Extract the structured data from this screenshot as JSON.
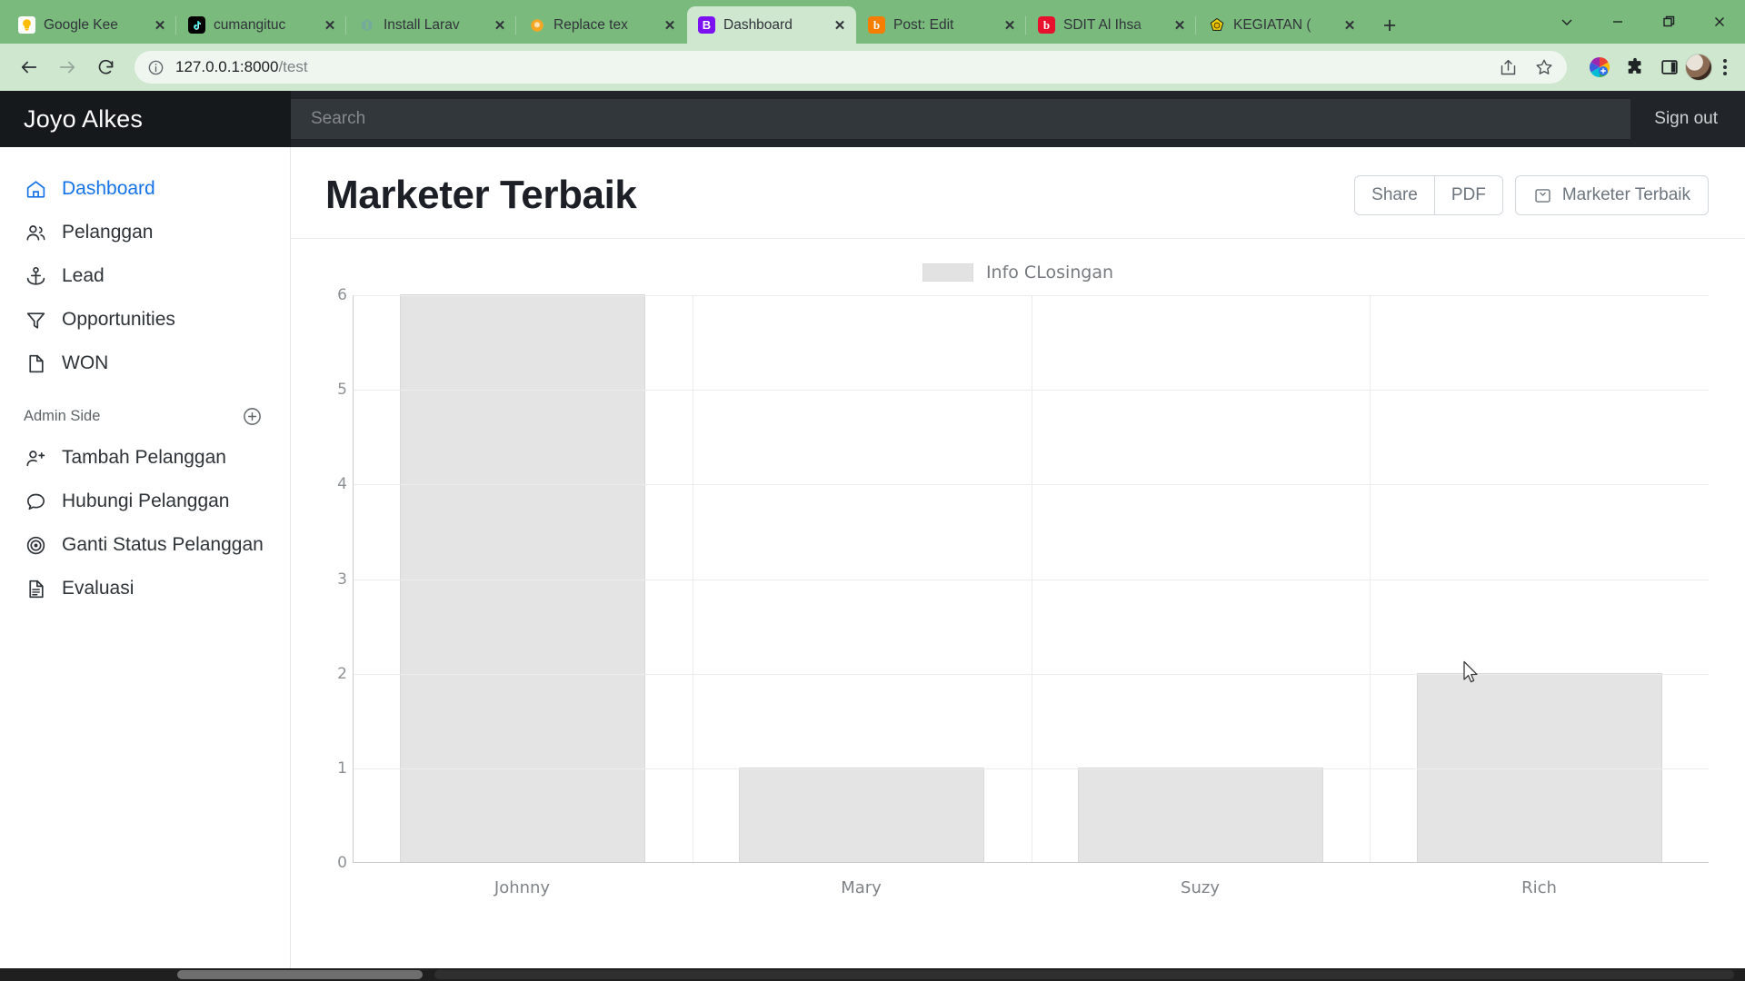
{
  "browser": {
    "tabs": [
      {
        "title": "Google Kee",
        "favicon": "keep-icon",
        "color": "#fbbc04",
        "active": false
      },
      {
        "title": "cumangituc",
        "favicon": "tiktok-icon",
        "color": "#000000",
        "active": false
      },
      {
        "title": "Install Larav",
        "favicon": "openai-icon",
        "color": "#74aa9c",
        "active": false
      },
      {
        "title": "Replace tex",
        "favicon": "orange-circle-icon",
        "color": "#f5a623",
        "active": false
      },
      {
        "title": "Dashboard",
        "favicon": "bootstrap-icon",
        "color": "#7b10f0",
        "active": true
      },
      {
        "title": "Post: Edit",
        "favicon": "blogger-icon",
        "color": "#f57d00",
        "active": false
      },
      {
        "title": "SDIT Al Ihsa",
        "favicon": "blogger-b-icon",
        "color": "#e8112d",
        "active": false
      },
      {
        "title": "KEGIATAN (",
        "favicon": "logo-icon",
        "color": "#f2d20a",
        "active": false
      }
    ],
    "new_tab_label": "+",
    "window_controls": [
      "chevron-down-icon",
      "minimize-icon",
      "maximize-icon",
      "close-icon"
    ],
    "nav": {
      "back": "back-arrow-icon",
      "forward": "forward-arrow-icon",
      "reload": "reload-icon"
    },
    "omnibox": {
      "site_info_icon": "info-circle-icon",
      "url_host": "127.0.0.1:8000",
      "url_path": "/test",
      "share_icon": "share-icon",
      "bookmark_icon": "star-icon"
    },
    "extensions": [
      "color-wheel-icon",
      "puzzle-extension-icon",
      "sidepanel-icon"
    ],
    "profile": "avatar",
    "menu": "kebab-menu-icon"
  },
  "app": {
    "brand": "Joyo Alkes",
    "search_placeholder": "Search",
    "search_value": "",
    "signout_label": "Sign out"
  },
  "sidebar": {
    "items": [
      {
        "label": "Dashboard",
        "icon": "home-icon",
        "active": true
      },
      {
        "label": "Pelanggan",
        "icon": "users-icon",
        "active": false
      },
      {
        "label": "Lead",
        "icon": "anchor-icon",
        "active": false
      },
      {
        "label": "Opportunities",
        "icon": "funnel-icon",
        "active": false
      },
      {
        "label": "WON",
        "icon": "file-icon",
        "active": false
      }
    ],
    "section": {
      "label": "Admin Side",
      "add_icon": "plus-circle-icon",
      "items": [
        {
          "label": "Tambah Pelanggan",
          "icon": "user-plus-icon"
        },
        {
          "label": "Hubungi Pelanggan",
          "icon": "chat-bubble-icon"
        },
        {
          "label": "Ganti Status Pelanggan",
          "icon": "target-icon"
        },
        {
          "label": "Evaluasi",
          "icon": "document-text-icon"
        }
      ]
    }
  },
  "page": {
    "title": "Marketer Terbaik",
    "actions": {
      "share_label": "Share",
      "pdf_label": "PDF",
      "primary_icon": "archive-icon",
      "primary_label": "Marketer Terbaik"
    }
  },
  "chart_data": {
    "type": "bar",
    "title": "",
    "categories": [
      "Johnny",
      "Mary",
      "Suzy",
      "Rich"
    ],
    "values": [
      6,
      1,
      1,
      2
    ],
    "series": [
      {
        "name": "Info CLosingan",
        "values": [
          6,
          1,
          1,
          2
        ]
      }
    ],
    "legend": [
      "Info CLosingan"
    ],
    "legend_position": "top-center",
    "xlabel": "",
    "ylabel": "",
    "ylim": [
      0,
      6
    ],
    "yticks": [
      0,
      1,
      2,
      3,
      4,
      5,
      6
    ],
    "grid": true,
    "bar_color": "#e4e4e4",
    "bar_border_color": "#d8d8d8"
  }
}
